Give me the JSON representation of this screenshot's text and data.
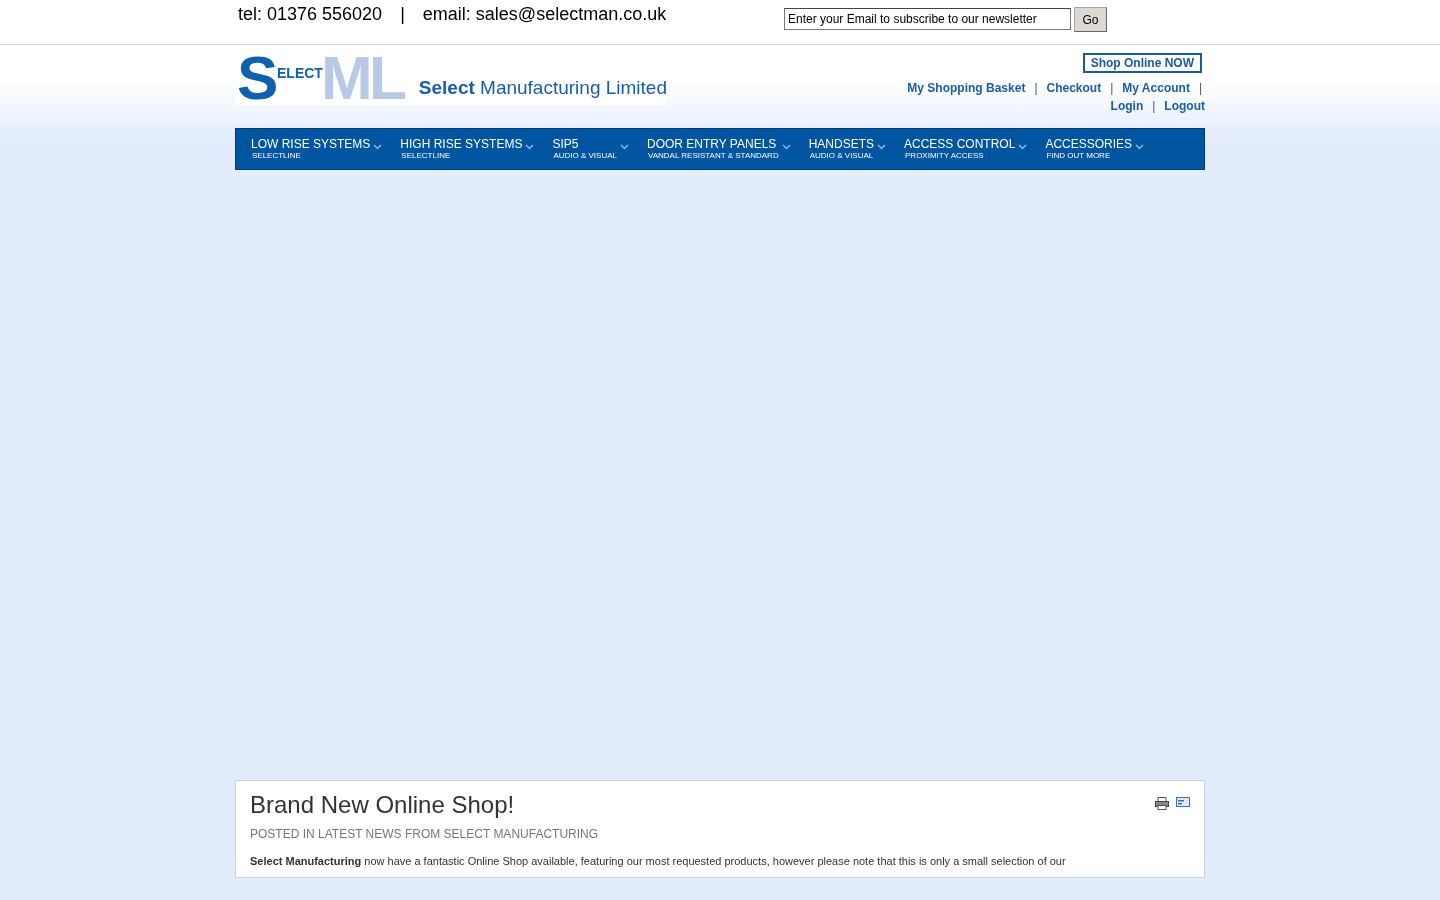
{
  "contact": {
    "phone": "tel: 01376 556020",
    "separator": "|",
    "email": "email: sales@selectman.co.uk"
  },
  "newsletter": {
    "placeholder": "Enter your Email to subscribe to our newsletter",
    "button": "Go"
  },
  "logo": {
    "letters": [
      "S",
      "M",
      "L"
    ],
    "word": "ELECT",
    "tagline": "**Select** Manufacturing Limited"
  },
  "shop_button": "Shop Online NOW",
  "account_links": [
    {
      "label": "My Shopping Basket",
      "separator": "|"
    },
    {
      "label": "Checkout",
      "separator": "|"
    },
    {
      "label": "My Account",
      "separator": "|"
    },
    {
      "label": "Login",
      "separator": "|"
    },
    {
      "label": "Logout"
    }
  ],
  "nav": [
    {
      "label": "LOW RISE SYSTEMS",
      "sub": "SELECTLINE"
    },
    {
      "label": "HIGH RISE SYSTEMS",
      "sub": "SELECTLINE"
    },
    {
      "label": "SIP5",
      "sub": "AUDIO & VISUAL"
    },
    {
      "label": "DOOR ENTRY PANELS",
      "sub": "VANDAL RESISTANT & STANDARD"
    },
    {
      "label": "HANDSETS",
      "sub": "AUDIO & VISUAL"
    },
    {
      "label": "ACCESS CONTROL",
      "sub": "PROXIMITY ACCESS"
    },
    {
      "label": "ACCESSORIES",
      "sub": "FIND OUT MORE"
    }
  ],
  "article": {
    "title": "Brand New Online Shop!",
    "meta": "POSTED IN LATEST NEWS FROM SELECT MANUFACTURING",
    "body": "**Select Manufacturing** now have a fantastic Online Shop available, featuring our most requested products, however please note that this is only a small selection of our"
  }
}
